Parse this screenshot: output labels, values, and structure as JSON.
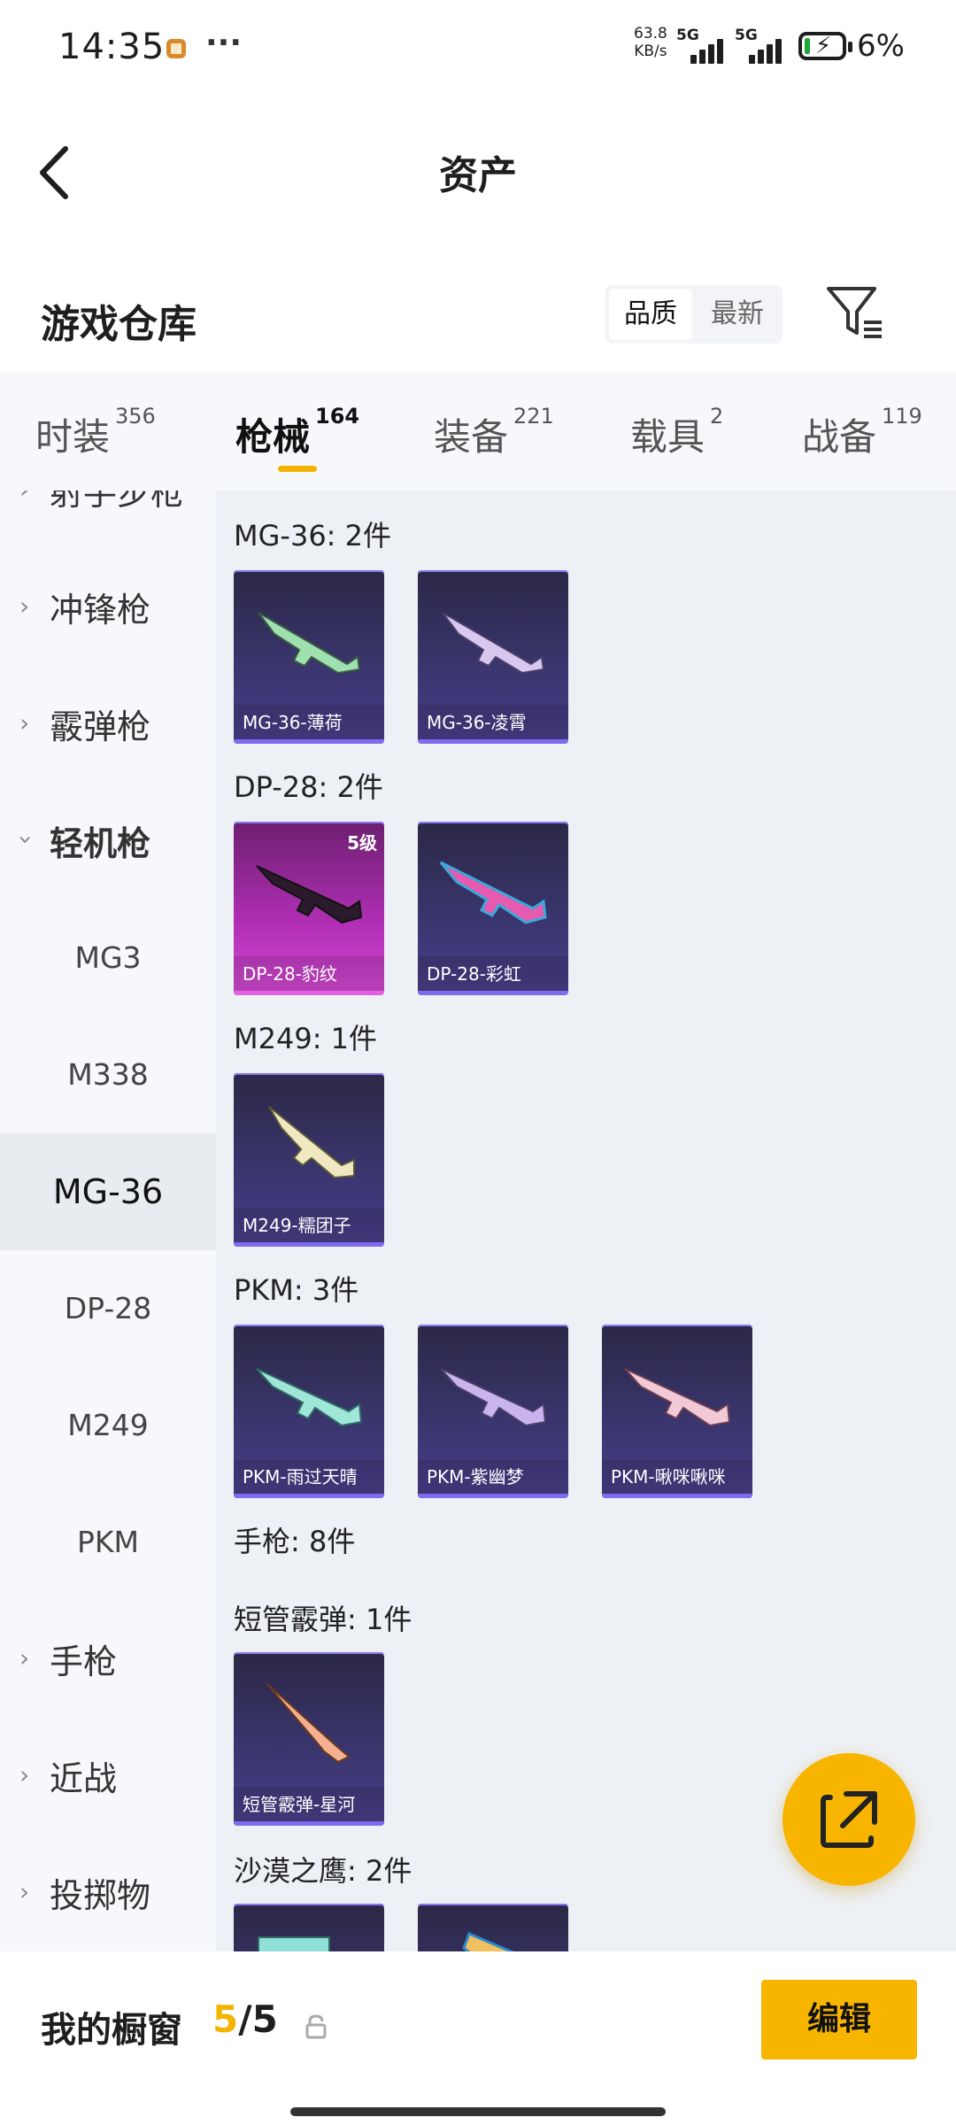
{
  "status": {
    "time": "14:35",
    "net_speed": "63.8",
    "net_unit": "KB/s",
    "sim1": "5G",
    "sim2": "5G",
    "battery": "6%"
  },
  "header": {
    "title": "资产",
    "back_icon": "chevron-left-icon"
  },
  "section": {
    "title": "游戏仓库",
    "sort_options": [
      "品质",
      "最新"
    ],
    "sort_selected": "品质",
    "filter_icon": "filter-icon"
  },
  "tabs": [
    {
      "label": "时装",
      "count": "356"
    },
    {
      "label": "枪械",
      "count": "164"
    },
    {
      "label": "装备",
      "count": "221"
    },
    {
      "label": "载具",
      "count": "2"
    },
    {
      "label": "战备",
      "count": "119"
    }
  ],
  "active_tab": "枪械",
  "sidebar": {
    "partial_top": "射手步枪",
    "categories": [
      "冲锋枪",
      "霰弹枪",
      "轻机枪"
    ],
    "subcategories": [
      "MG3",
      "M338",
      "MG-36",
      "DP-28",
      "M249",
      "PKM"
    ],
    "selected_sub": "MG-36",
    "more_categories": [
      "手枪",
      "近战",
      "投掷物"
    ]
  },
  "groups": [
    {
      "title": "MG-36: 2件",
      "items": [
        {
          "name": "MG-36-薄荷",
          "tier": "purple"
        },
        {
          "name": "MG-36-凌霄",
          "tier": "purple"
        }
      ]
    },
    {
      "title": "DP-28: 2件",
      "items": [
        {
          "name": "DP-28-豹纹",
          "tier": "pink",
          "level": "5级"
        },
        {
          "name": "DP-28-彩虹",
          "tier": "purple"
        }
      ]
    },
    {
      "title": "M249: 1件",
      "items": [
        {
          "name": "M249-糯团子",
          "tier": "purple"
        }
      ]
    },
    {
      "title": "PKM: 3件",
      "items": [
        {
          "name": "PKM-雨过天晴",
          "tier": "purple"
        },
        {
          "name": "PKM-紫幽梦",
          "tier": "purple"
        },
        {
          "name": "PKM-啾咪啾咪",
          "tier": "purple"
        }
      ]
    },
    {
      "title": "手枪: 8件",
      "items": []
    },
    {
      "title": "短管霰弹: 1件",
      "items": [
        {
          "name": "短管霰弹-星河",
          "tier": "purple"
        }
      ]
    },
    {
      "title": "沙漠之鹰: 2件",
      "items": [
        {
          "name": "",
          "tier": "purple"
        },
        {
          "name": "",
          "tier": "purple"
        }
      ]
    }
  ],
  "fab_icon": "share-icon",
  "bottom": {
    "title": "我的橱窗",
    "current": "5",
    "total": "/5",
    "lock_icon": "lock-icon",
    "edit_label": "编辑"
  },
  "colors": {
    "accent": "#f7b500",
    "purple_card": "#3b3670",
    "pink_card": "#b22fb6"
  }
}
